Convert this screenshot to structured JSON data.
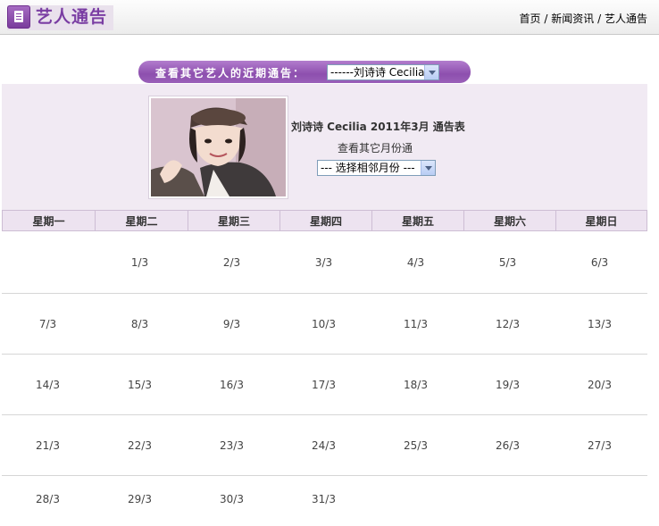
{
  "header": {
    "title": "艺人通告",
    "breadcrumb": [
      "首页",
      "新闻资讯",
      "艺人通告"
    ],
    "separator": "/"
  },
  "selector": {
    "label": "查看其它艺人的近期通告：",
    "selected": "------刘诗诗 Cecilia"
  },
  "profile": {
    "name_line": "刘诗诗  Cecilia 2011年3月 通告表",
    "sub_line": "查看其它月份通",
    "month_select": "--- 选择相邻月份 ---"
  },
  "calendar": {
    "weekdays": [
      "星期一",
      "星期二",
      "星期三",
      "星期四",
      "星期五",
      "星期六",
      "星期日"
    ],
    "weeks": [
      [
        "",
        "1/3",
        "2/3",
        "3/3",
        "4/3",
        "5/3",
        "6/3"
      ],
      [
        "7/3",
        "8/3",
        "9/3",
        "10/3",
        "11/3",
        "12/3",
        "13/3"
      ],
      [
        "14/3",
        "15/3",
        "16/3",
        "17/3",
        "18/3",
        "19/3",
        "20/3"
      ],
      [
        "21/3",
        "22/3",
        "23/3",
        "24/3",
        "25/3",
        "26/3",
        "27/3"
      ],
      [
        "28/3",
        "29/3",
        "30/3",
        "31/3",
        "",
        "",
        ""
      ]
    ]
  },
  "colors": {
    "accent": "#8d4fae",
    "panel_bg": "#f1eaf3",
    "header_cell_bg": "#ede3f0"
  }
}
